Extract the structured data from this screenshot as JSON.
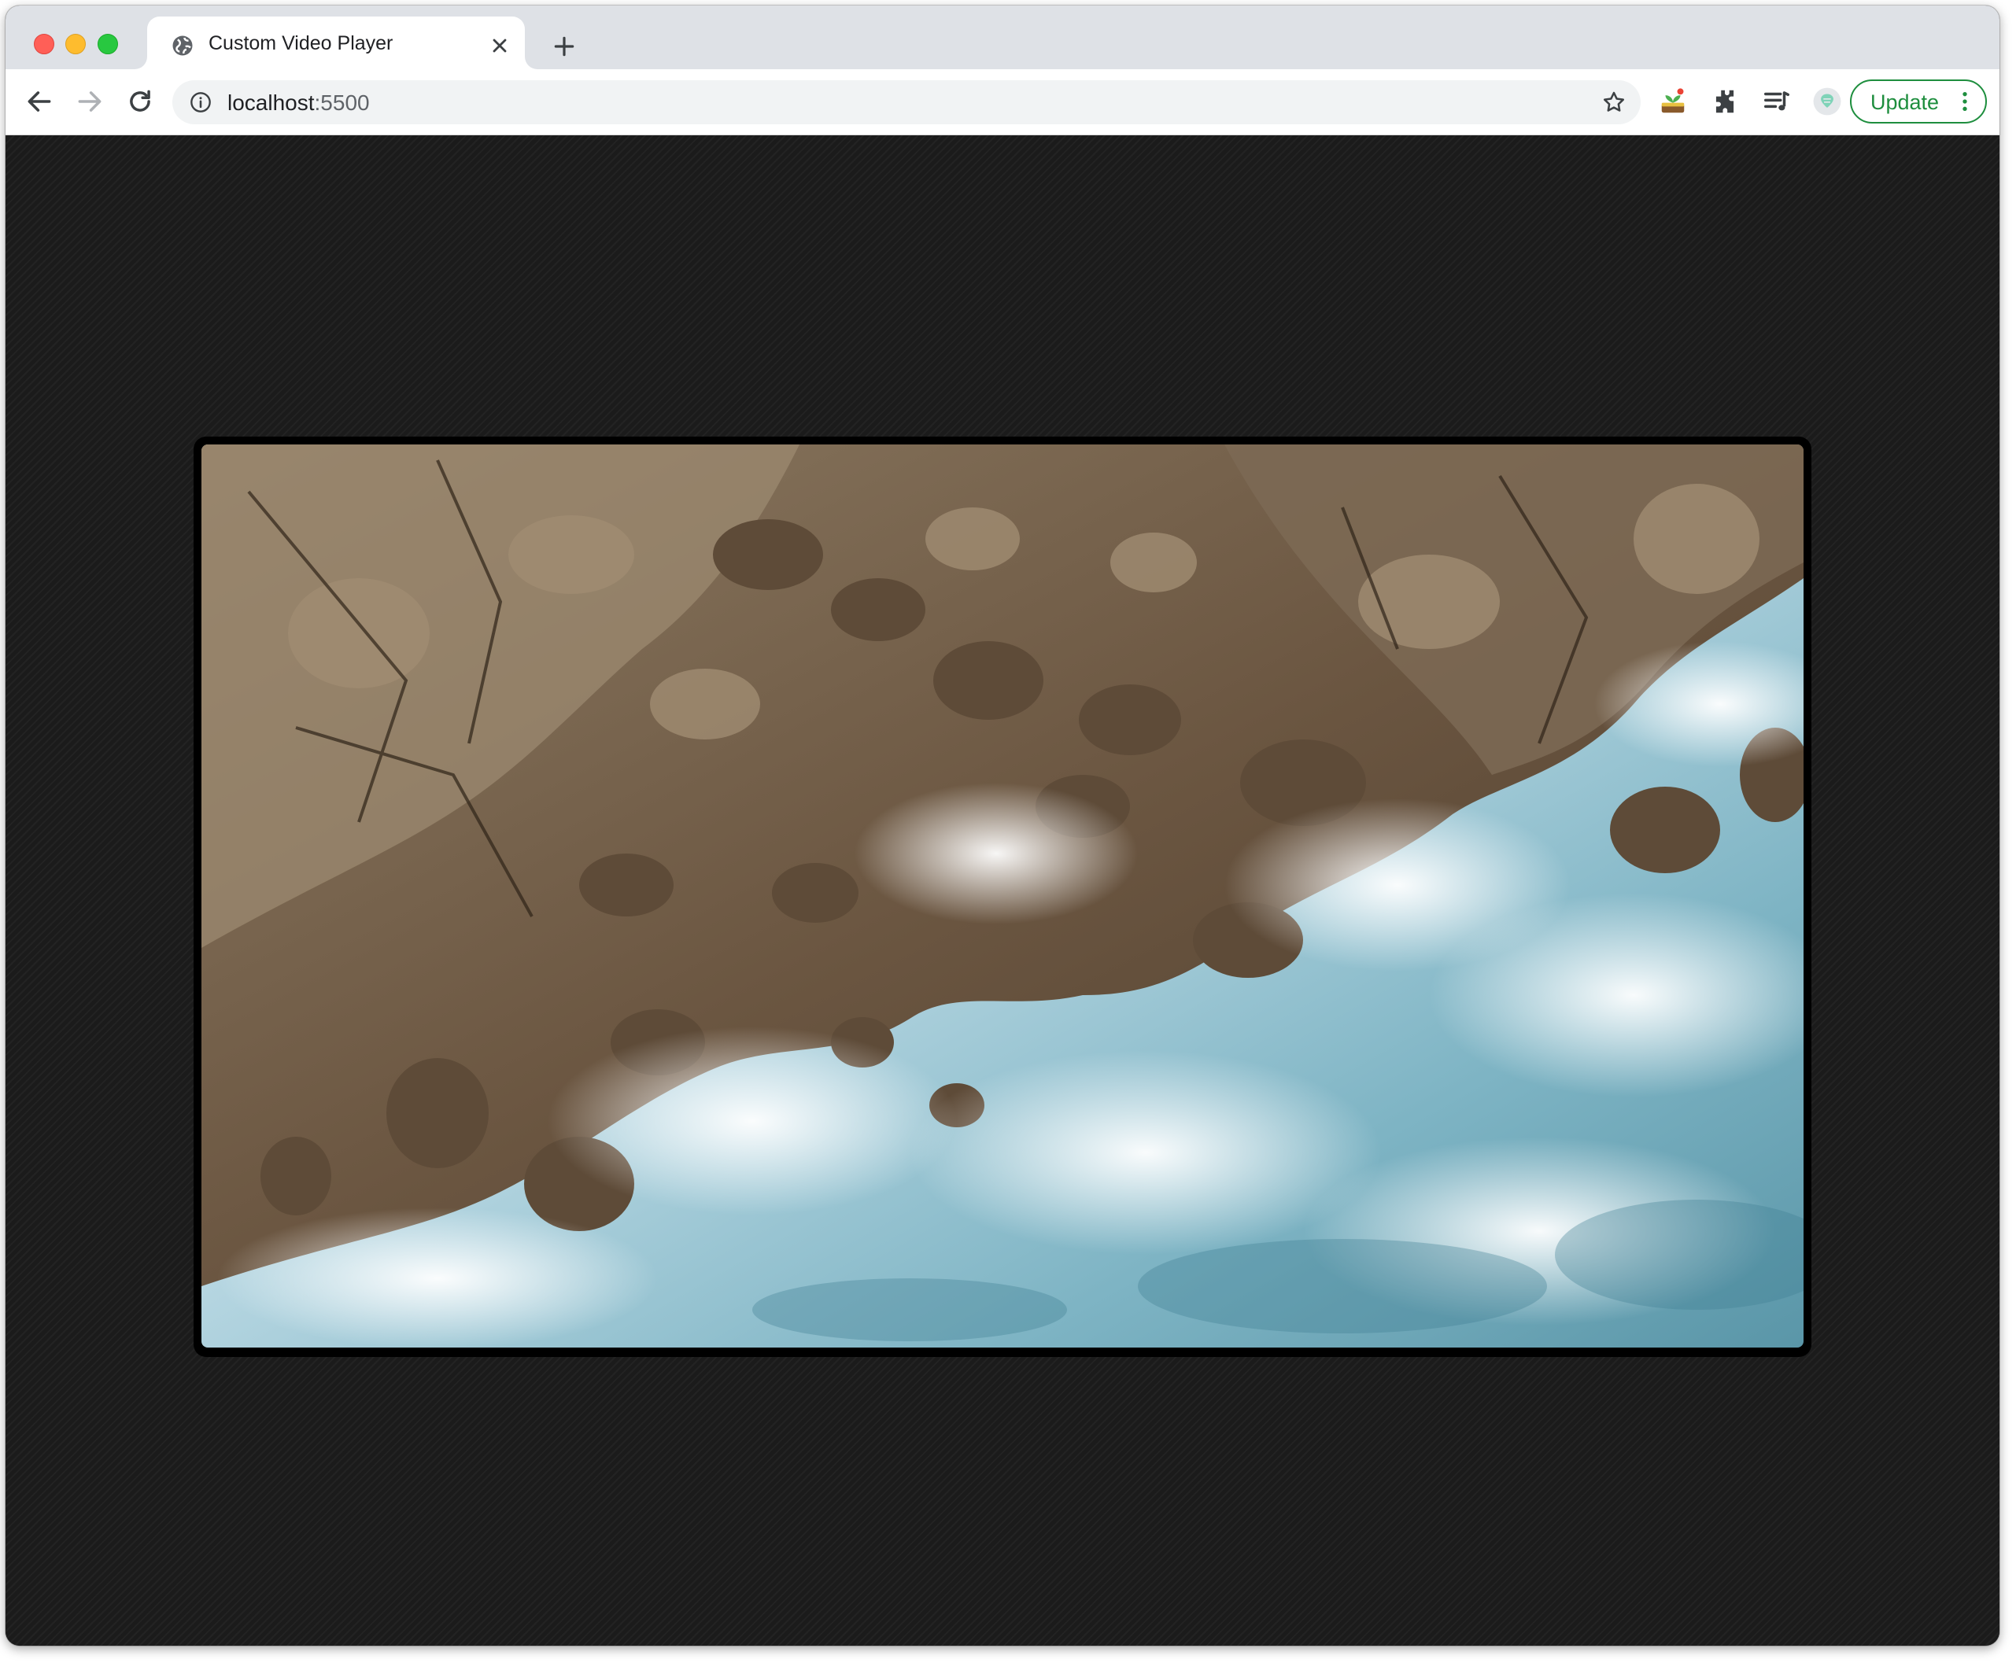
{
  "browser": {
    "tab_title": "Custom Video Player",
    "url_host": "localhost",
    "url_port": ":5500",
    "update_label": "Update"
  },
  "video": {
    "scene": "aerial coastline rocks with crashing waves"
  },
  "colors": {
    "accent_update": "#1e8e3e",
    "tabstrip": "#dee1e6",
    "page_background": "#1b1b1b"
  }
}
